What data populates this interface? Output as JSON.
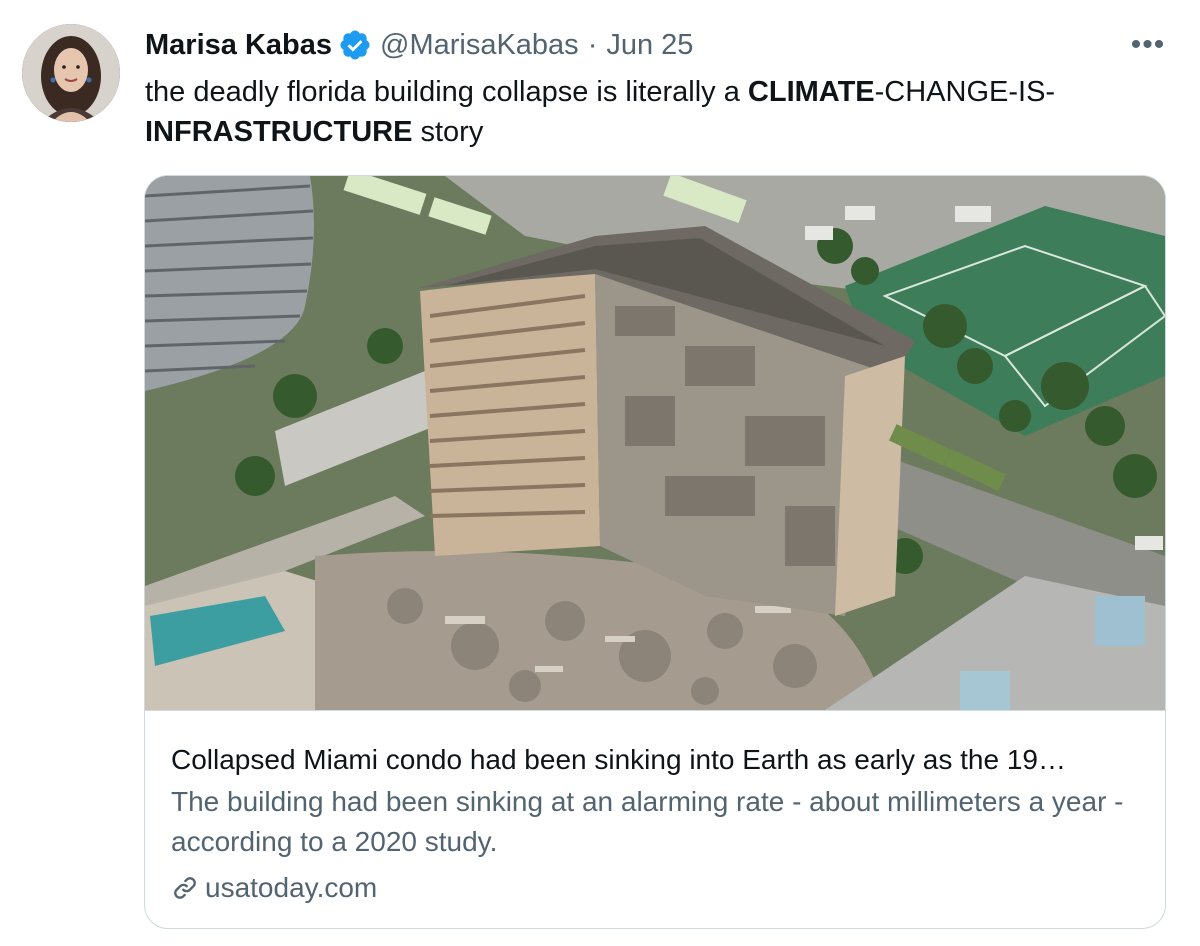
{
  "tweet": {
    "author": {
      "display_name": "Marisa Kabas",
      "handle": "@MarisaKabas",
      "verified_icon": "verified-badge-icon",
      "avatar": "avatar-photo"
    },
    "separator": "·",
    "date": "Jun 25",
    "more_icon": "more-options-icon",
    "more_glyph": "•••",
    "text_parts": {
      "p1": "the deadly florida building collapse is literally a ",
      "p2_bold": "CLIMATE",
      "p3": "-CHANGE-IS-",
      "p4_bold": "INFRASTRUCTURE",
      "p5": " story"
    }
  },
  "card": {
    "image": "collapsed-building-aerial-photo",
    "title": "Collapsed Miami condo had been sinking into Earth as early as the 19…",
    "description": "The building had been sinking at an alarming rate - about millimeters a year - according to a 2020 study.",
    "domain": "usatoday.com",
    "domain_icon": "link-icon"
  },
  "colors": {
    "text_primary": "#0f1419",
    "text_secondary": "#536471",
    "verified_blue": "#1d9bf0",
    "card_border": "#cfd9de"
  }
}
